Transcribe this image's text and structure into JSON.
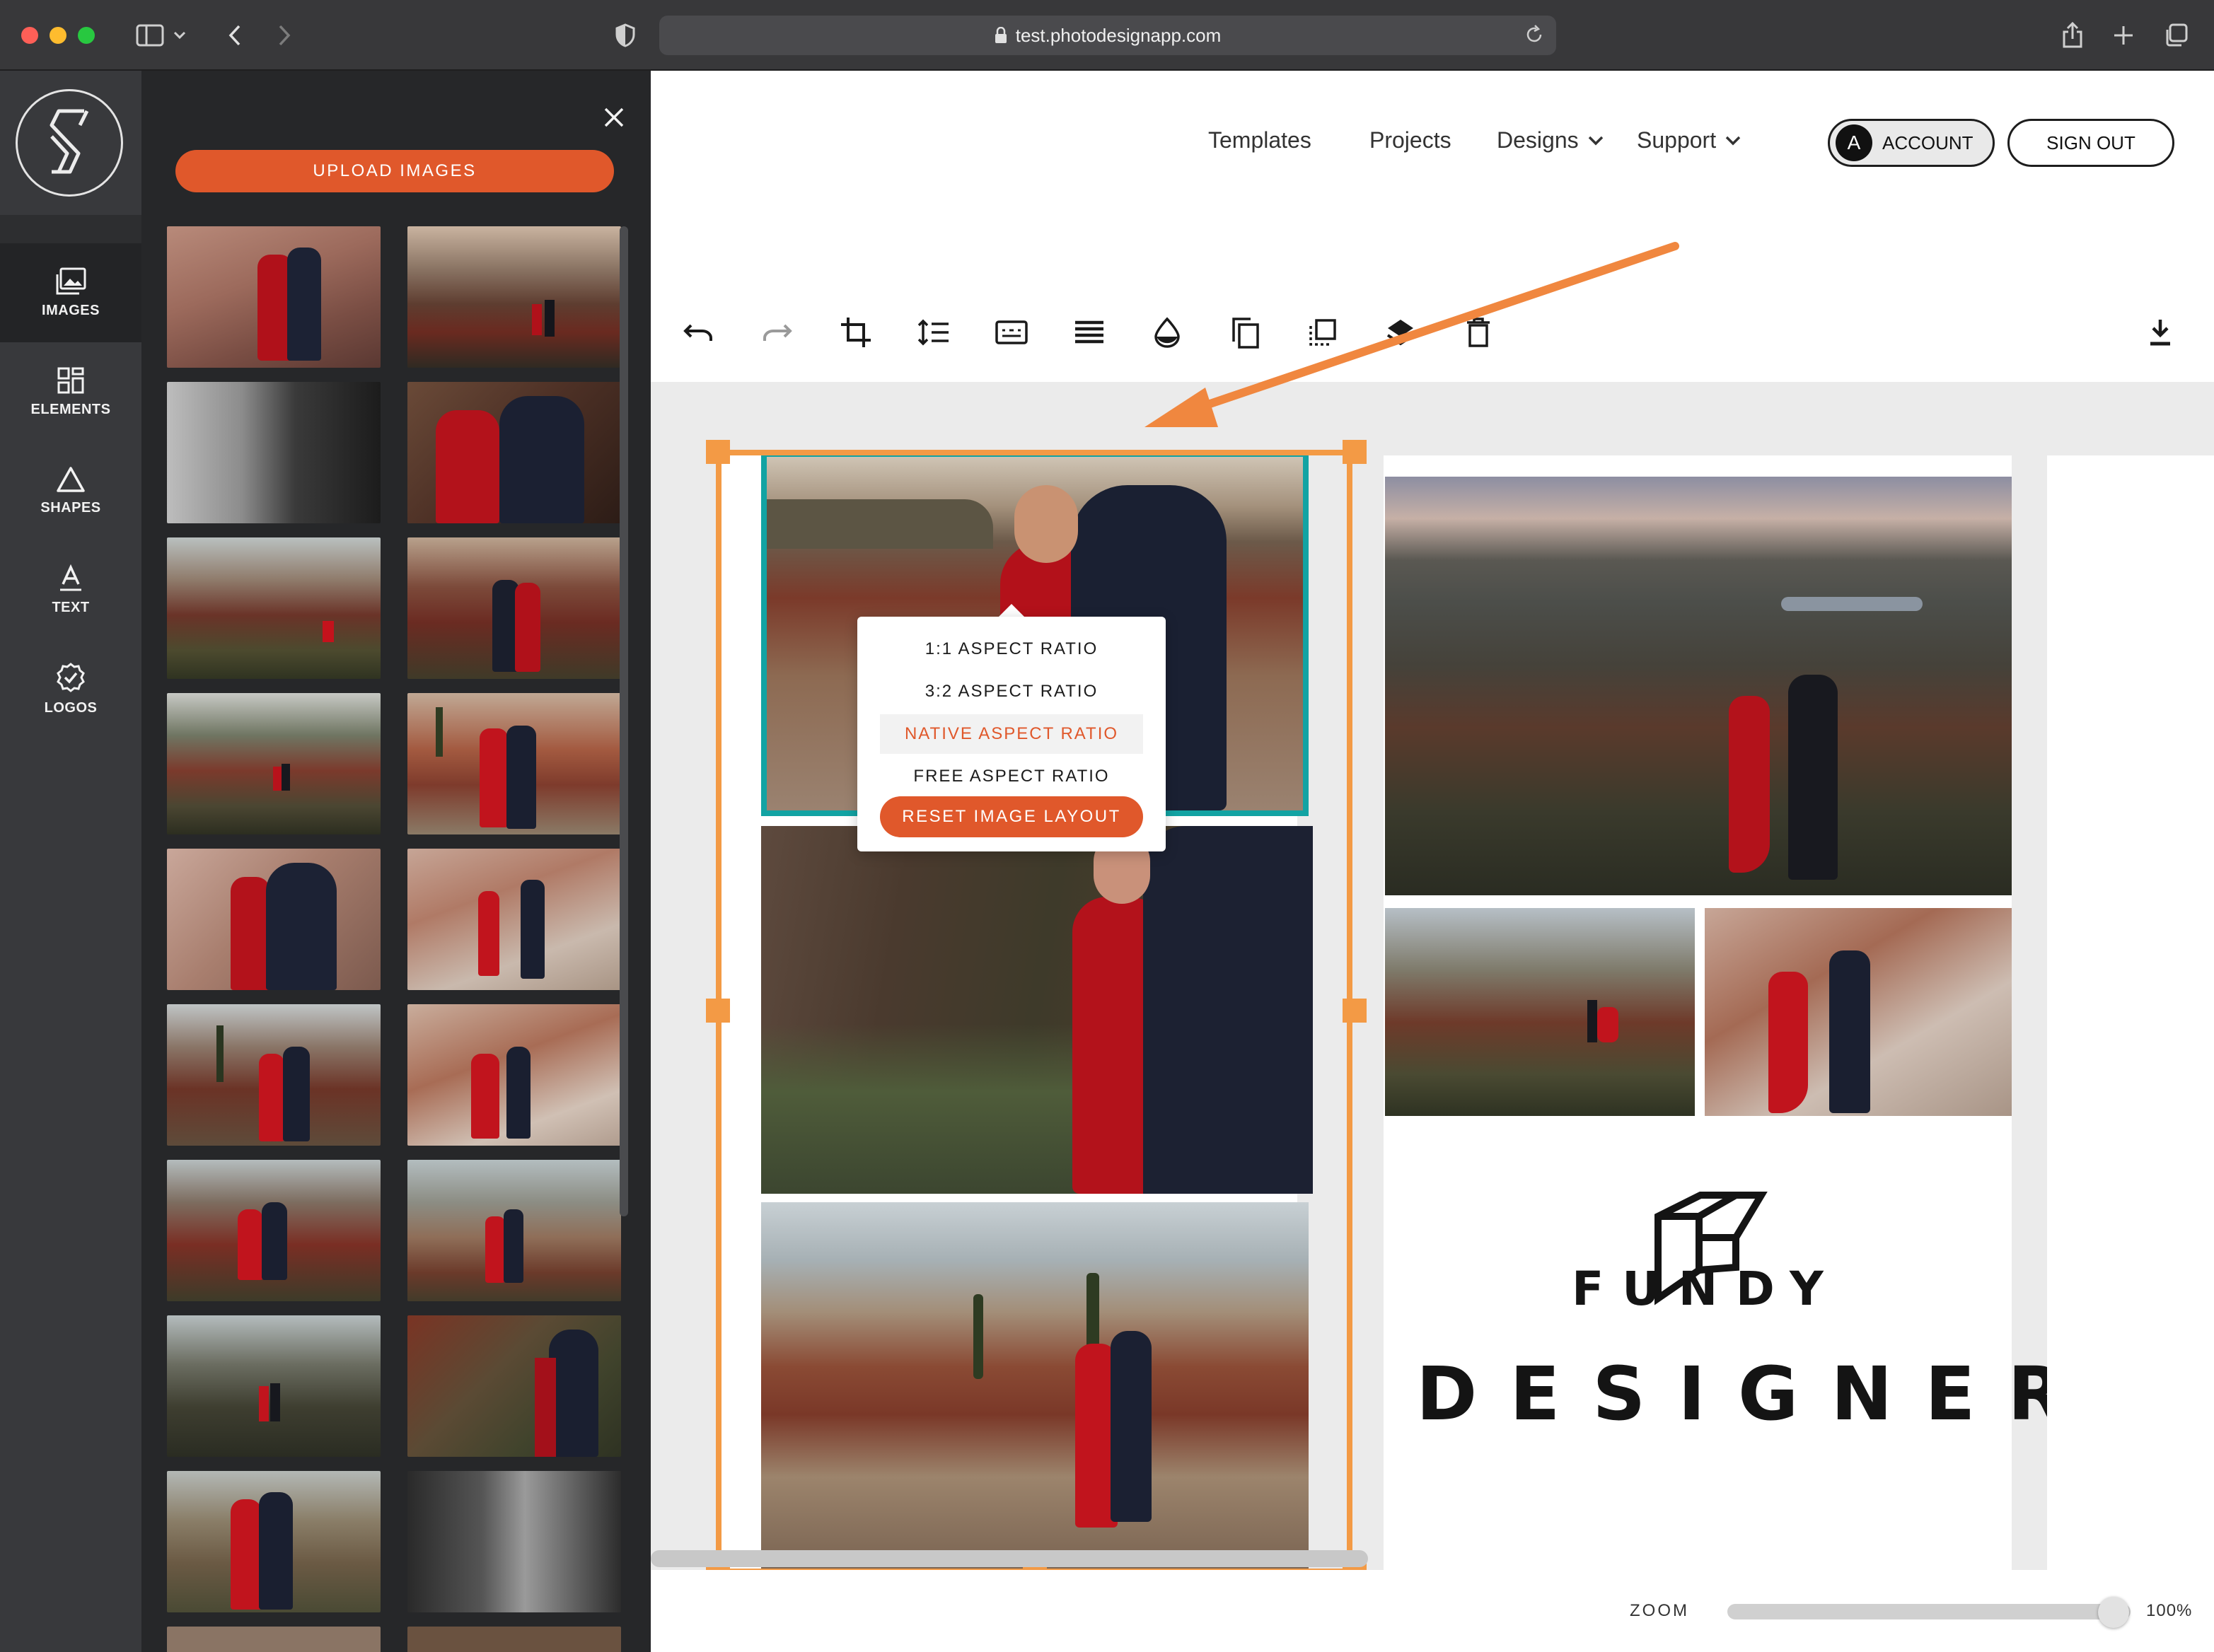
{
  "browser": {
    "url": "test.photodesignapp.com"
  },
  "rail": {
    "items": [
      {
        "label": "IMAGES",
        "icon": "images-icon"
      },
      {
        "label": "ELEMENTS",
        "icon": "elements-icon"
      },
      {
        "label": "SHAPES",
        "icon": "shapes-icon"
      },
      {
        "label": "TEXT",
        "icon": "text-icon"
      },
      {
        "label": "LOGOS",
        "icon": "logos-icon"
      }
    ]
  },
  "panel": {
    "upload_label": "UPLOAD IMAGES",
    "thumb_count": 20
  },
  "nav": {
    "templates": "Templates",
    "projects": "Projects",
    "designs": "Designs",
    "support": "Support",
    "account_initial": "A",
    "account_label": "ACCOUNT",
    "signout_label": "SIGN OUT"
  },
  "toolbar": {
    "tools": [
      "undo-icon",
      "redo-icon",
      "crop-icon",
      "line-spacing-icon",
      "aspect-ratio-icon",
      "align-icon",
      "opacity-icon",
      "duplicate-icon",
      "frame-icon",
      "layers-icon",
      "delete-icon",
      "download-icon"
    ]
  },
  "aspect_menu": {
    "items": [
      "1:1 ASPECT RATIO",
      "3:2 ASPECT RATIO",
      "NATIVE ASPECT RATIO",
      "FREE ASPECT RATIO"
    ],
    "highlighted": "NATIVE ASPECT RATIO",
    "reset_label": "RESET IMAGE LAYOUT"
  },
  "canvas": {
    "brand_line1": "FUNDY",
    "brand_line2": "DESIGNER"
  },
  "zoom": {
    "label": "ZOOM",
    "value": "100%",
    "level": 1.0
  },
  "colors": {
    "accent": "#e0582b",
    "selection": "#f39a45",
    "active_image": "#12a3a3",
    "annotation_arrow": "#f0873f"
  }
}
